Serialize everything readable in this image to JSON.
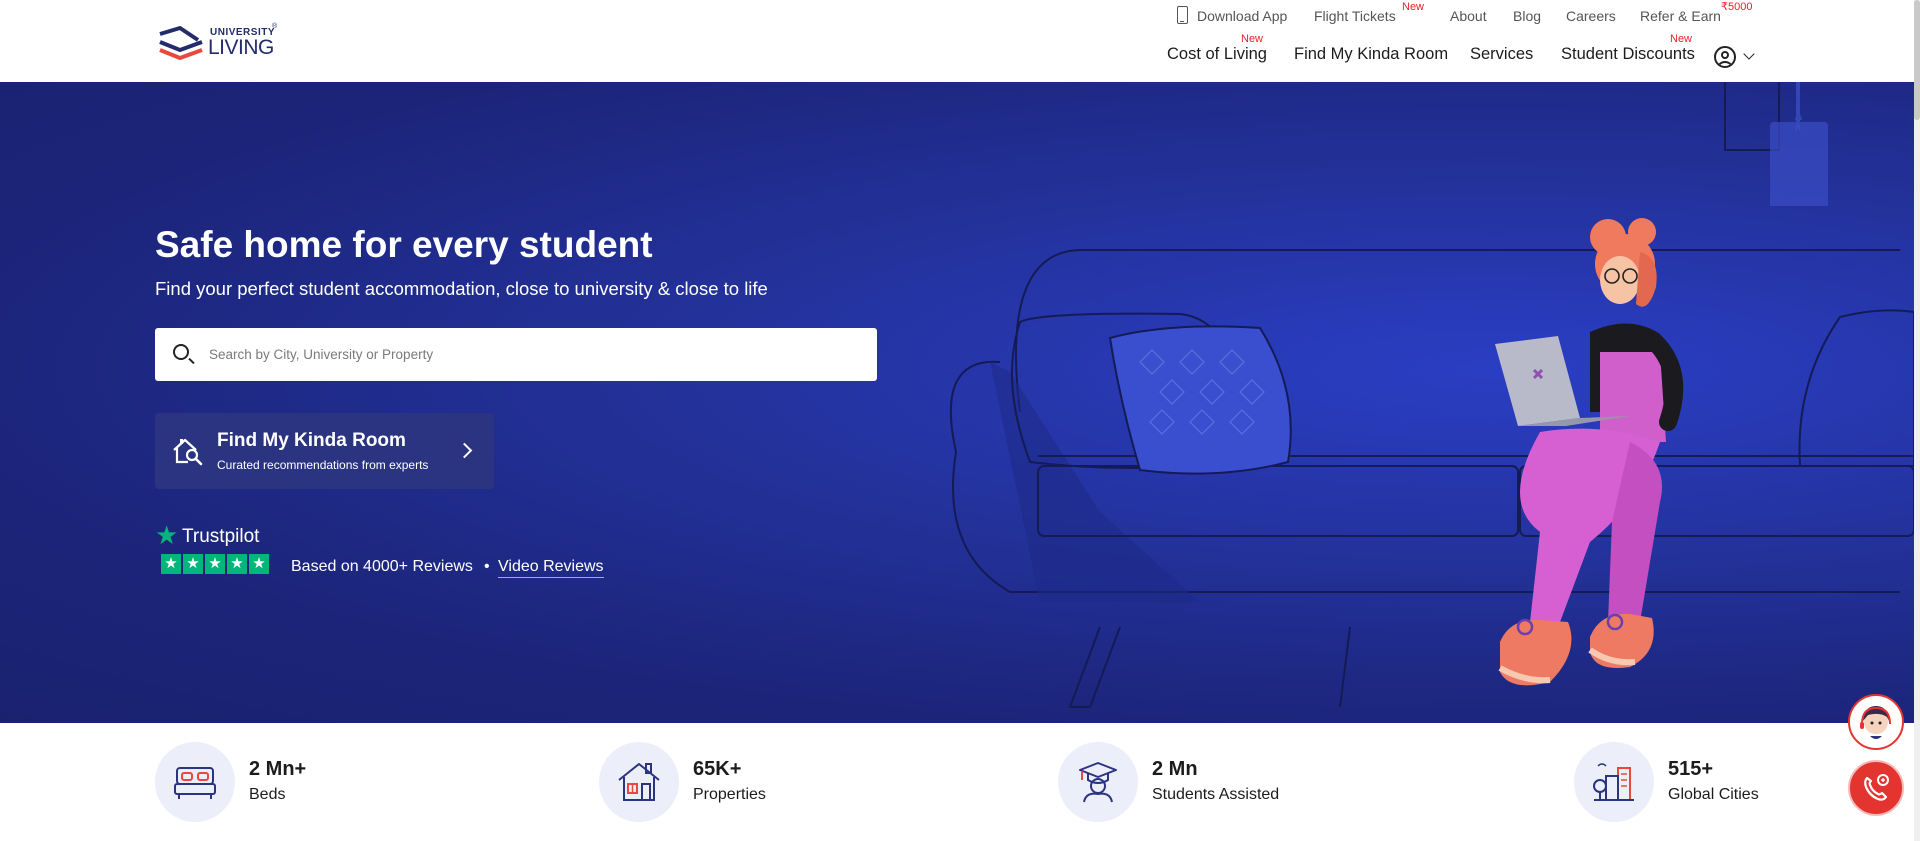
{
  "header": {
    "logo": {
      "line1": "UNIVERSITY",
      "line2": "LIVING",
      "mark": "®"
    },
    "topnav": {
      "download_app": "Download App",
      "flight_tickets": "Flight Tickets",
      "flight_badge": "New",
      "about": "About",
      "blog": "Blog",
      "careers": "Careers",
      "refer_earn": "Refer & Earn",
      "refer_badge": "₹5000"
    },
    "mainnav": {
      "cost_of_living": "Cost of Living",
      "cost_badge": "New",
      "find_my_kinda_room": "Find My Kinda Room",
      "services": "Services",
      "student_discounts": "Student Discounts",
      "discounts_badge": "New"
    }
  },
  "hero": {
    "title": "Safe home for every student",
    "subtitle": "Find your perfect student accommodation, close to university & close to life",
    "search": {
      "placeholder": "Search by City, University or Property",
      "value": ""
    },
    "fmkr": {
      "title": "Find My Kinda Room",
      "subtitle": "Curated recommendations from experts"
    },
    "trustpilot": {
      "brand": "Trustpilot",
      "star": "★",
      "rating_stars": [
        "★",
        "★",
        "★",
        "★",
        "★"
      ],
      "reviews_text": "Based on 4000+ Reviews",
      "separator": "•",
      "video_reviews": "Video Reviews"
    }
  },
  "stats": [
    {
      "value": "2 Mn+",
      "label": "Beds",
      "icon": "bed-icon"
    },
    {
      "value": "65K+",
      "label": "Properties",
      "icon": "house-icon"
    },
    {
      "value": "2 Mn",
      "label": "Students Assisted",
      "icon": "graduate-icon"
    },
    {
      "value": "515+",
      "label": "Global Cities",
      "icon": "city-icon"
    }
  ],
  "colors": {
    "hero_bg": "#1b2478",
    "accent_red": "#e3232b",
    "trustpilot_green": "#00b67a",
    "card_bg": "#2b3480",
    "stat_circle": "#eceefa"
  },
  "floating": {
    "chat_icon": "support-agent-icon",
    "call_icon": "phone-call-icon"
  }
}
